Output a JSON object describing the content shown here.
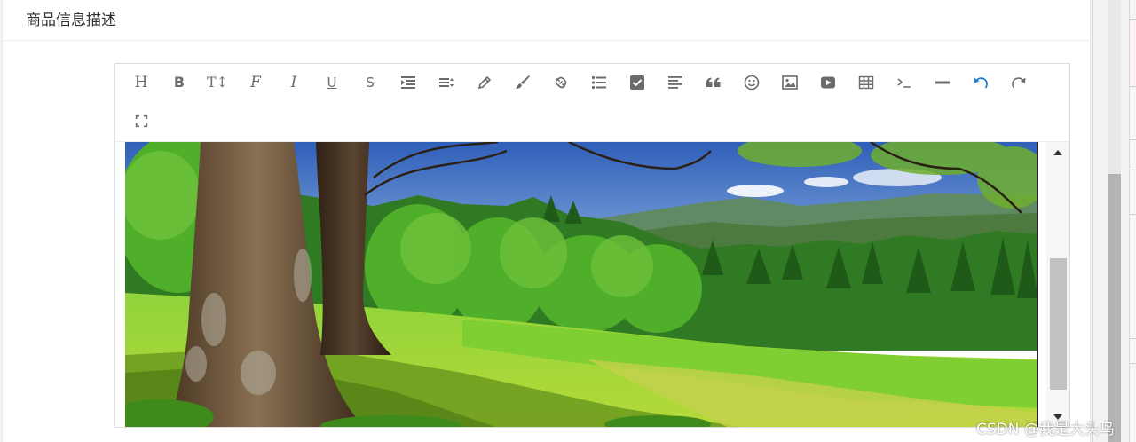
{
  "card": {
    "title": "商品信息描述"
  },
  "toolbar": {
    "buttons": [
      {
        "name": "heading",
        "icon": "heading-icon",
        "label": "H"
      },
      {
        "name": "bold",
        "icon": "bold-icon",
        "label": "B"
      },
      {
        "name": "font-size",
        "icon": "font-size-icon",
        "label": "T↕"
      },
      {
        "name": "font-family",
        "icon": "font-family-icon",
        "label": "F"
      },
      {
        "name": "italic",
        "icon": "italic-icon",
        "label": "I"
      },
      {
        "name": "underline",
        "icon": "underline-icon",
        "label": "U"
      },
      {
        "name": "strikethrough",
        "icon": "strikethrough-icon",
        "label": "S"
      },
      {
        "name": "indent",
        "icon": "indent-icon"
      },
      {
        "name": "line-height",
        "icon": "line-height-icon"
      },
      {
        "name": "font-color",
        "icon": "pencil-icon"
      },
      {
        "name": "background-color",
        "icon": "brush-icon"
      },
      {
        "name": "link",
        "icon": "link-icon"
      },
      {
        "name": "list",
        "icon": "list-icon"
      },
      {
        "name": "todo",
        "icon": "checkbox-icon"
      },
      {
        "name": "justify",
        "icon": "align-left-icon"
      },
      {
        "name": "quote",
        "icon": "quote-icon"
      },
      {
        "name": "emoticon",
        "icon": "smiley-icon"
      },
      {
        "name": "image",
        "icon": "image-icon"
      },
      {
        "name": "video",
        "icon": "video-icon"
      },
      {
        "name": "table",
        "icon": "table-icon"
      },
      {
        "name": "code",
        "icon": "code-icon"
      },
      {
        "name": "split-line",
        "icon": "horizontal-rule-icon"
      },
      {
        "name": "undo",
        "icon": "undo-icon"
      },
      {
        "name": "redo",
        "icon": "redo-icon"
      },
      {
        "name": "fullscreen",
        "icon": "fullscreen-icon"
      }
    ]
  },
  "content": {
    "image": "forest-meadow-image"
  },
  "watermark": {
    "text": "CSDN @我是大头鸟"
  },
  "colors": {
    "accent": "#1c7fd6",
    "icon": "#6b6b6b"
  }
}
